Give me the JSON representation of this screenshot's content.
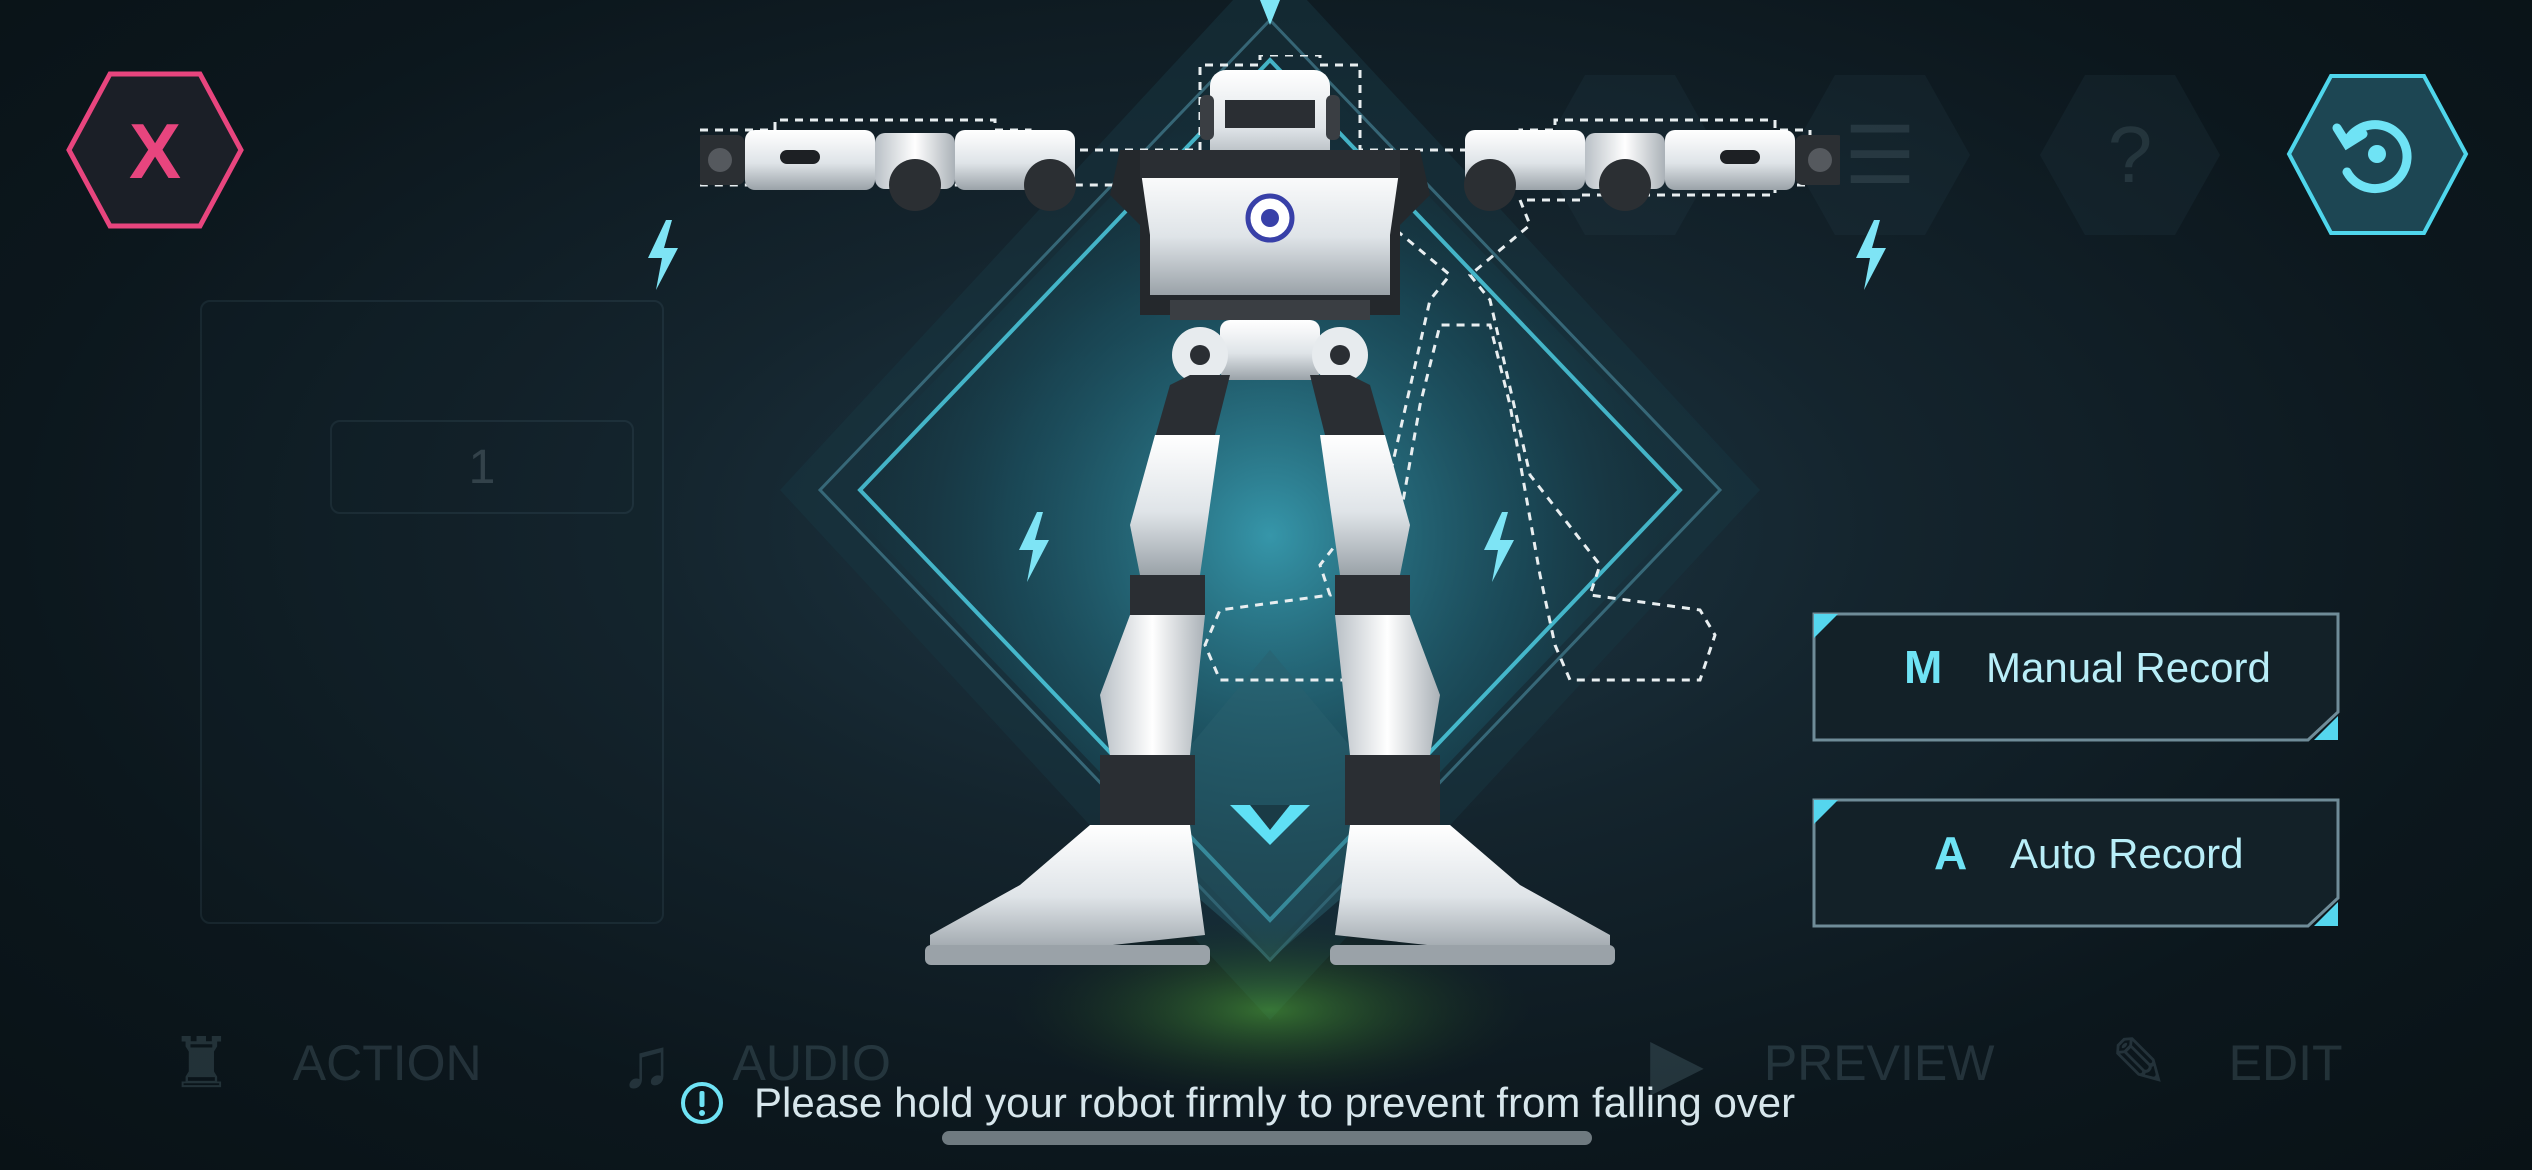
{
  "toolbar": {
    "close_label": "X",
    "reset_icon": "rotate-reset-icon"
  },
  "background": {
    "frame_number": "1",
    "tabs": [
      {
        "label": "ACTION",
        "icon": "robot-icon"
      },
      {
        "label": "AUDIO",
        "icon": "music-note-icon"
      },
      {
        "label": "PREVIEW",
        "icon": "play-icon"
      },
      {
        "label": "EDIT",
        "icon": "pencil-icon"
      }
    ],
    "hex_icons": [
      "save-icon",
      "list-icon",
      "help-icon"
    ],
    "help_glyph": "?"
  },
  "record": {
    "manual": {
      "letter": "M",
      "label": "Manual Record"
    },
    "auto": {
      "letter": "A",
      "label": "Auto Record"
    }
  },
  "notice": {
    "text": "Please hold your robot firmly to prevent from falling over",
    "icon": "info-circle-icon"
  },
  "colors": {
    "accent": "#4fd6ec",
    "close": "#e8457e",
    "background": "#0f1d24"
  }
}
